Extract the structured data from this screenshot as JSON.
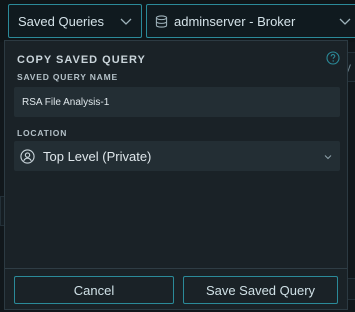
{
  "topbar": {
    "saved_queries_label": "Saved Queries",
    "server_label": "adminserver - Broker"
  },
  "modal": {
    "title": "COPY SAVED QUERY",
    "name_label": "SAVED QUERY NAME",
    "name_value": "RSA File Analysis-1",
    "location_label": "LOCATION",
    "location_value": "Top Level (Private)",
    "cancel_label": "Cancel",
    "save_label": "Save Saved Query"
  },
  "background": {
    "edge_glyph": "y"
  },
  "colors": {
    "accent": "#2b8a99",
    "modal_bg": "#1a2227",
    "field_bg": "#232e34",
    "page_bg": "#11171b"
  }
}
